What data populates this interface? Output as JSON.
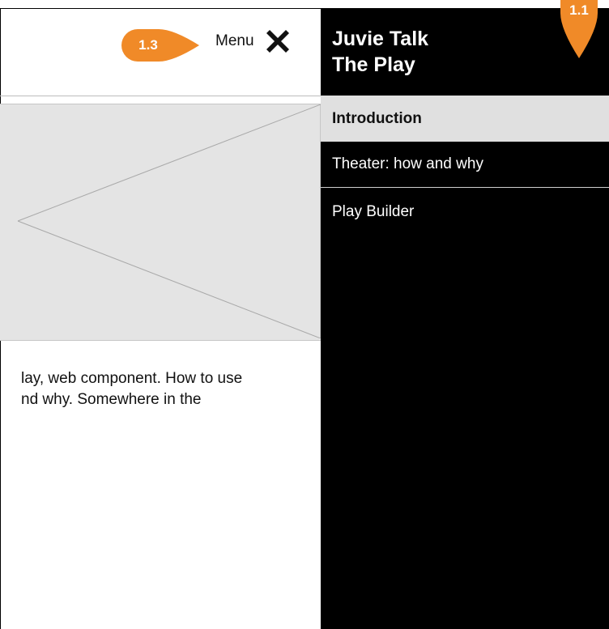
{
  "header": {
    "menu_label": "Menu",
    "close_icon": "close-x-icon"
  },
  "hero": {
    "image_icon": "image-placeholder-icon",
    "fill_color": "#e4e4e4"
  },
  "body": {
    "line1": "lay, web component. How to use",
    "line2": "nd why. Somewhere in the"
  },
  "drawer": {
    "title_line1": "Juvie Talk",
    "title_line2": "The Play",
    "background": "#000000",
    "items": [
      {
        "label": "Introduction",
        "active": true
      },
      {
        "label": "Theater: how and why",
        "active": false
      },
      {
        "label": "Play Builder",
        "active": false
      }
    ]
  },
  "annotations": {
    "callout_1": "1.3",
    "callout_2": "1.1",
    "color": "#f08a28"
  }
}
